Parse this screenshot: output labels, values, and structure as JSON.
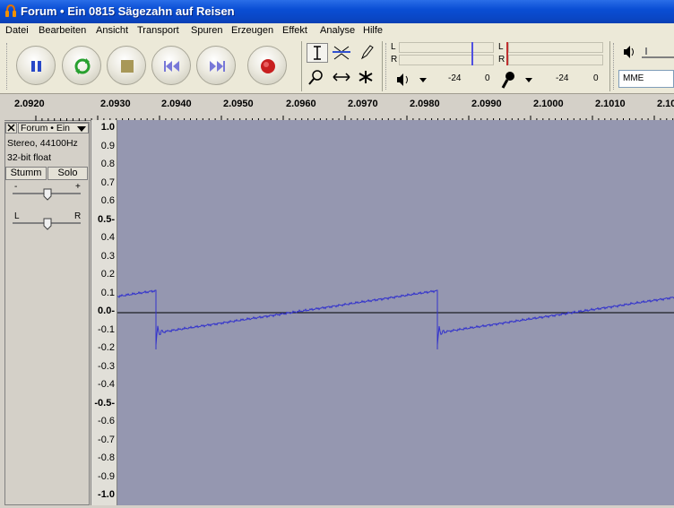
{
  "window": {
    "title": "Forum • Ein 0815 Sägezahn auf Reisen"
  },
  "menu": [
    "Datei",
    "Bearbeiten",
    "Ansicht",
    "Transport",
    "Spuren",
    "Erzeugen",
    "Effekt",
    "Analyse",
    "Hilfe"
  ],
  "meters": {
    "play_L": "L",
    "play_R": "R",
    "rec_L": "L",
    "rec_R": "R",
    "play_db1": "-24",
    "play_db2": "0",
    "rec_db1": "-24",
    "rec_db2": "0"
  },
  "device": {
    "value": "MME"
  },
  "ruler": {
    "ticks": [
      "2.0920",
      "2.0930",
      "2.0940",
      "2.0950",
      "2.0960",
      "2.0970",
      "2.0980",
      "2.0990",
      "2.1000",
      "2.1010",
      "2.10"
    ]
  },
  "track": {
    "name": "Forum • Ein",
    "format": "Stereo, 44100Hz",
    "bitdepth": "32-bit float",
    "mute_label": "Stumm",
    "solo_label": "Solo",
    "gain_minus": "-",
    "gain_plus": "+",
    "pan_left": "L",
    "pan_right": "R"
  },
  "vertical_scale": {
    "labels": [
      "1.0",
      "0.9",
      "0.8",
      "0.7",
      "0.6",
      "0.5-",
      "0.4",
      "0.3",
      "0.2",
      "0.1",
      "0.0-",
      "-0.1",
      "-0.2",
      "-0.3",
      "-0.4",
      "-0.5-",
      "-0.6",
      "-0.7",
      "-0.8",
      "-0.9",
      "-1.0"
    ]
  },
  "colors": {
    "waveform": "#3333cc",
    "track_bg": "#9597b0",
    "titlebar": "#0a4ed4"
  }
}
